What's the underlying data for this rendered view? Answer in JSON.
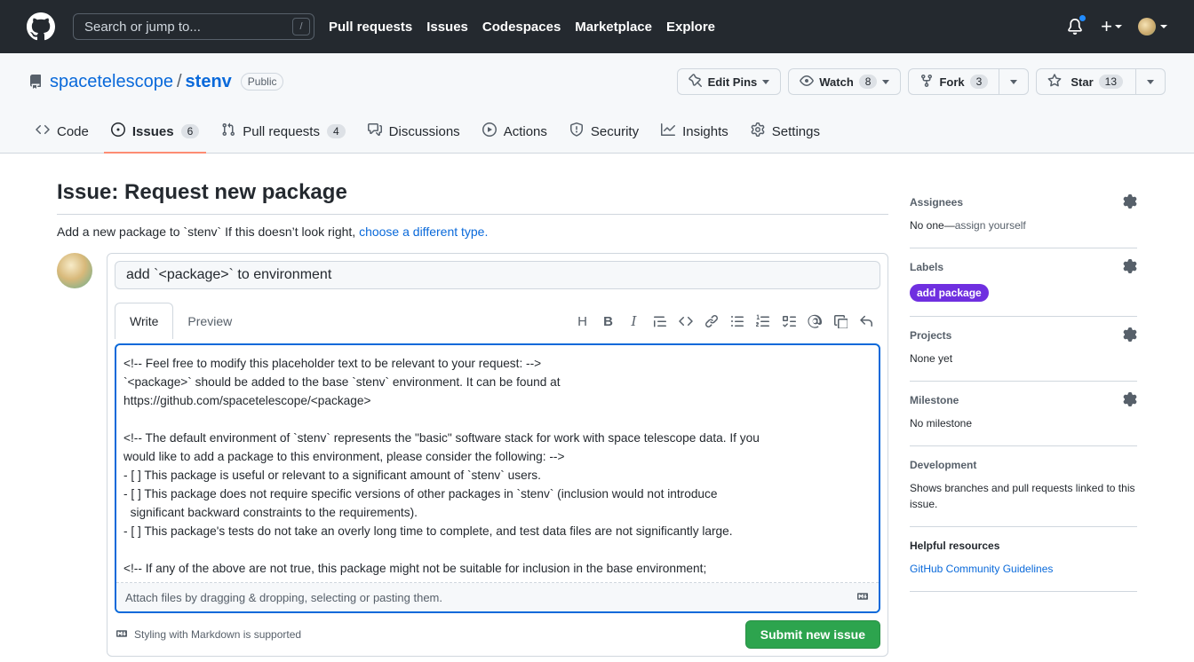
{
  "header": {
    "search_placeholder": "Search or jump to...",
    "search_shortcut": "/",
    "nav": [
      "Pull requests",
      "Issues",
      "Codespaces",
      "Marketplace",
      "Explore"
    ]
  },
  "repo": {
    "owner": "spacetelescope",
    "separator": "/",
    "name": "stenv",
    "visibility": "Public",
    "edit_pins": "Edit Pins",
    "watch": "Watch",
    "watch_count": "8",
    "fork": "Fork",
    "fork_count": "3",
    "star": "Star",
    "star_count": "13"
  },
  "tabs": [
    {
      "label": "Code"
    },
    {
      "label": "Issues",
      "count": "6"
    },
    {
      "label": "Pull requests",
      "count": "4"
    },
    {
      "label": "Discussions"
    },
    {
      "label": "Actions"
    },
    {
      "label": "Security"
    },
    {
      "label": "Insights"
    },
    {
      "label": "Settings"
    }
  ],
  "issue": {
    "heading": "Issue: Request new package",
    "subtitle_text": "Add a new package to `stenv` If this doesn’t look right, ",
    "subtitle_link": "choose a different type.",
    "title_value": "add `<package>` to environment",
    "write_tab": "Write",
    "preview_tab": "Preview",
    "body": "<!-- Feel free to modify this placeholder text to be relevant to your request: -->\n`<package>` should be added to the base `stenv` environment. It can be found at\nhttps://github.com/spacetelescope/<package>\n\n<!-- The default environment of `stenv` represents the \"basic\" software stack for work with space telescope data. If you\nwould like to add a package to this environment, please consider the following: -->\n- [ ] This package is useful or relevant to a significant amount of `stenv` users.\n- [ ] This package does not require specific versions of other packages in `stenv` (inclusion would not introduce\n  significant backward constraints to the requirements).\n- [ ] This package's tests do not take an overly long time to complete, and test data files are not significantly large.\n\n<!-- If any of the above are not true, this package might not be suitable for inclusion in the base environment;",
    "attach_text": "Attach files by dragging & dropping, selecting or pasting them.",
    "markdown_note": "Styling with Markdown is supported",
    "submit_label": "Submit new issue"
  },
  "sidebar": {
    "assignees_title": "Assignees",
    "assignees_value": "No one—",
    "assign_yourself": "assign yourself",
    "labels_title": "Labels",
    "label_value": "add package",
    "label_color": "#6f2fe0",
    "projects_title": "Projects",
    "projects_value": "None yet",
    "milestone_title": "Milestone",
    "milestone_value": "No milestone",
    "development_title": "Development",
    "development_value": "Shows branches and pull requests linked to this issue.",
    "resources_title": "Helpful resources",
    "resources_link": "GitHub Community Guidelines"
  },
  "colors": {
    "header_bg": "#24292f",
    "accent_link": "#0969da",
    "submit_green": "#2da44e",
    "active_tab_underline": "#fd8c73",
    "focus_border": "#0969da"
  }
}
